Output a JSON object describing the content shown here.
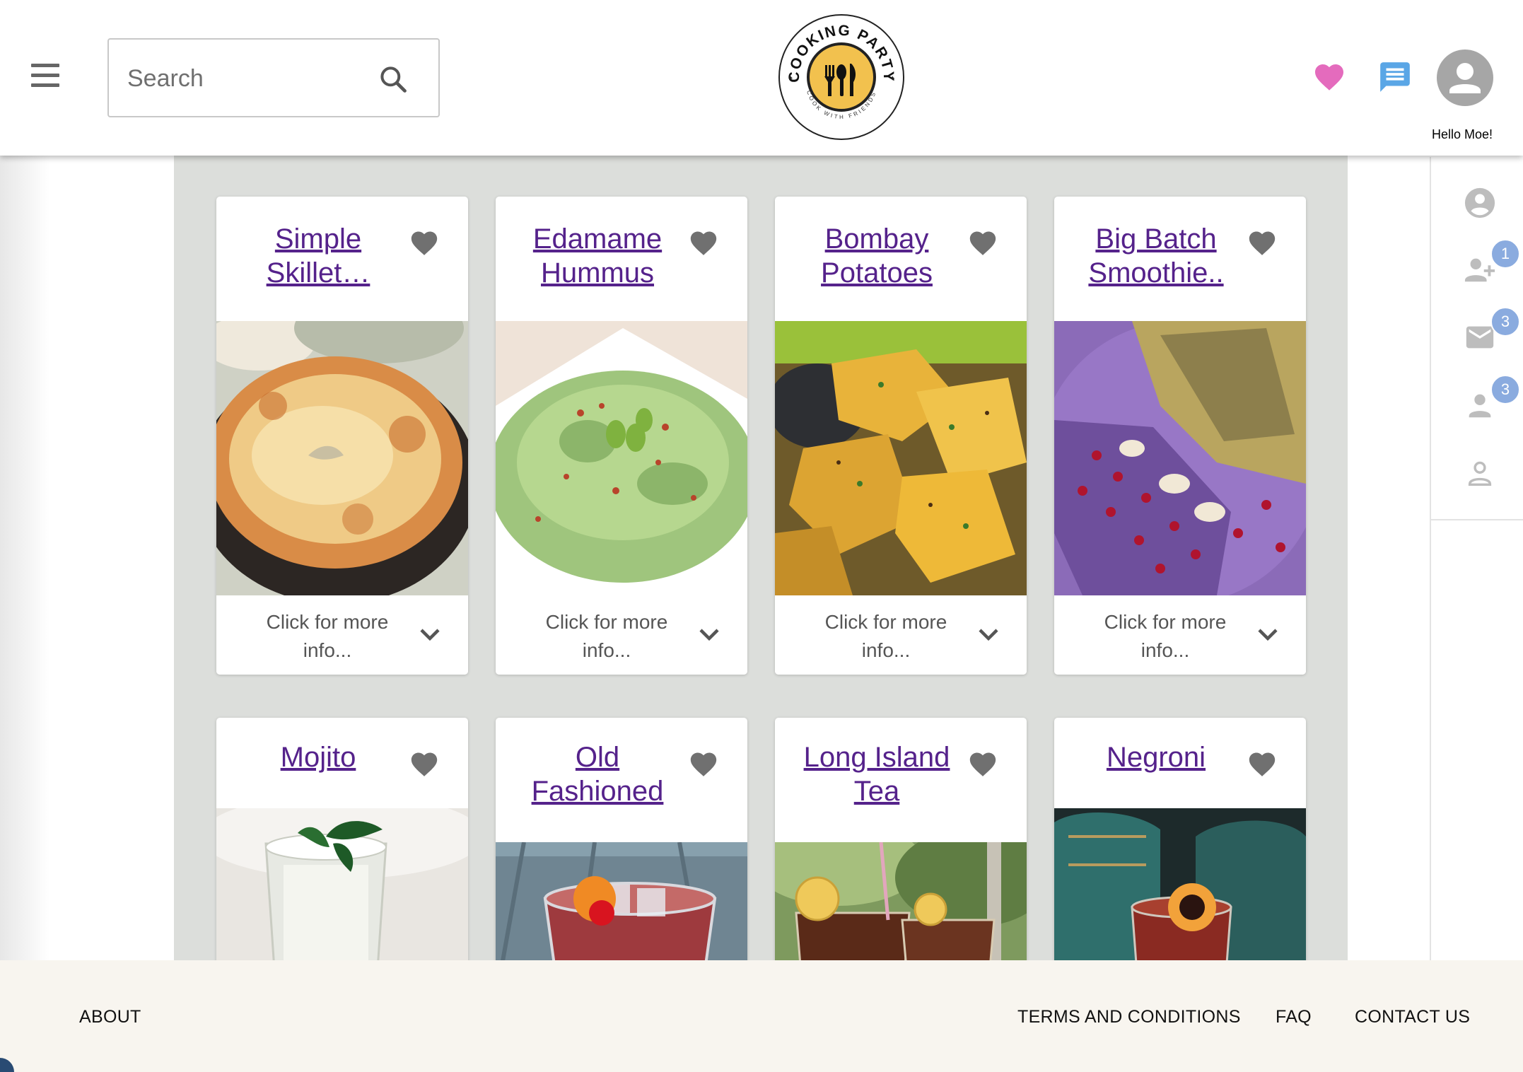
{
  "header": {
    "search_placeholder": "Search",
    "logo": {
      "top_text": "COOKING PARTY",
      "bottom_text": "COOK WITH FRIENDS",
      "accent_color": "#f2c14e"
    },
    "greeting": "Hello Moe!",
    "heart_color": "#e46bbd",
    "chat_color": "#5aa6e6"
  },
  "sidebar": {
    "items": [
      {
        "icon": "account-circle-icon",
        "badge": ""
      },
      {
        "icon": "person-add-icon",
        "badge": "1"
      },
      {
        "icon": "mail-icon",
        "badge": "3"
      },
      {
        "icon": "person-icon",
        "badge": "3"
      },
      {
        "icon": "person-outline-icon",
        "badge": ""
      }
    ]
  },
  "recipes": [
    {
      "title_line1": "Simple",
      "title_line2": "Skillet…",
      "info": "Click for more info...",
      "image": "skillet-pizza"
    },
    {
      "title_line1": "Edamame",
      "title_line2": "Hummus",
      "info": "Click for more info...",
      "image": "edamame-hummus"
    },
    {
      "title_line1": "Bombay",
      "title_line2": "Potatoes",
      "info": "Click for more info...",
      "image": "bombay-potatoes"
    },
    {
      "title_line1": "Big Batch",
      "title_line2": "Smoothie..",
      "info": "Click for more info...",
      "image": "smoothie-bowl"
    },
    {
      "title_line1": "Mojito",
      "title_line2": "",
      "image": "mojito-glass"
    },
    {
      "title_line1": "Old",
      "title_line2": "Fashioned",
      "image": "old-fashioned-glass"
    },
    {
      "title_line1": "Long Island",
      "title_line2": "Tea",
      "image": "iced-tea-glasses"
    },
    {
      "title_line1": "Negroni",
      "title_line2": "",
      "image": "negroni-glass"
    }
  ],
  "footer": {
    "about": "ABOUT",
    "terms": "TERMS AND CONDITIONS",
    "faq": "FAQ",
    "contact": "CONTACT US"
  }
}
